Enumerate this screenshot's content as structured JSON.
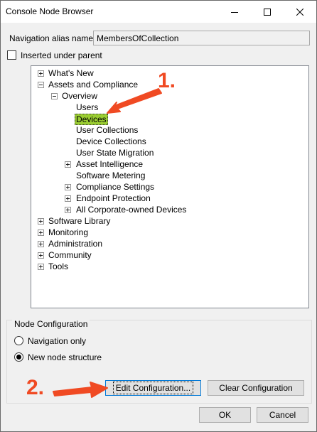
{
  "window": {
    "title": "Console Node Browser"
  },
  "titlebar_icons": [
    "minimize-icon",
    "maximize-icon",
    "close-icon"
  ],
  "alias": {
    "label": "Navigation alias name:",
    "value": "MembersOfCollection"
  },
  "inserted_under_parent": {
    "label": "Inserted under parent",
    "checked": false
  },
  "tree": {
    "whats_new": "What's New",
    "assets": "Assets and Compliance",
    "overview": "Overview",
    "users": "Users",
    "devices": "Devices",
    "user_collections": "User Collections",
    "device_collections": "Device Collections",
    "user_state_migration": "User State Migration",
    "asset_intelligence": "Asset Intelligence",
    "software_metering": "Software Metering",
    "compliance_settings": "Compliance Settings",
    "endpoint_protection": "Endpoint Protection",
    "corporate_devices": "All Corporate-owned Devices",
    "software_library": "Software Library",
    "monitoring": "Monitoring",
    "administration": "Administration",
    "community": "Community",
    "tools": "Tools"
  },
  "node_config": {
    "title": "Node Configuration",
    "navigation_only": "Navigation only",
    "new_node_structure": "New node structure",
    "selected": "New node structure",
    "edit_button": "Edit Configuration...",
    "clear_button": "Clear Configuration"
  },
  "footer": {
    "ok": "OK",
    "cancel": "Cancel"
  },
  "annotations": {
    "step1": "1.",
    "step2": "2.",
    "color": "#f04a23"
  },
  "colors": {
    "selection": "#9acd32",
    "dialog_bg": "#f0f0f0"
  }
}
